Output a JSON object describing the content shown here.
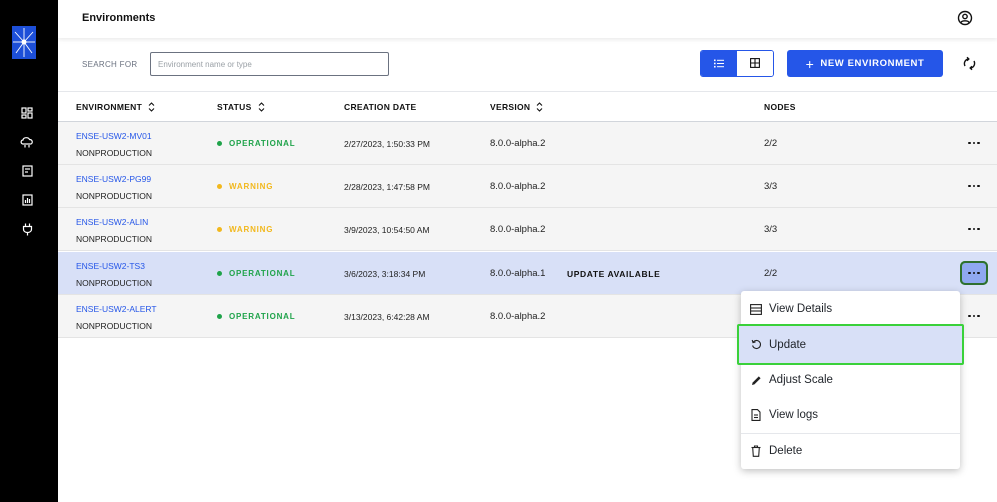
{
  "app": {
    "page_title": "Environments"
  },
  "toolbar": {
    "search_label": "SEARCH FOR",
    "search_placeholder": "Environment name or type",
    "search_value": "",
    "new_env_label": "NEW ENVIRONMENT",
    "new_env_icon": "plus-icon",
    "view_modes": [
      "list-view-icon",
      "grid-view-icon"
    ],
    "active_view": "list"
  },
  "sidebar": {
    "items": [
      {
        "icon": "dashboard-icon"
      },
      {
        "icon": "cloud-icon"
      },
      {
        "icon": "document-icon"
      },
      {
        "icon": "chart-icon"
      },
      {
        "icon": "plug-icon"
      }
    ]
  },
  "table": {
    "columns": [
      "ENVIRONMENT",
      "STATUS",
      "CREATION DATE",
      "VERSION",
      "NODES"
    ],
    "rows": [
      {
        "name": "ENSE-USW2-MV01",
        "type": "NONPRODUCTION",
        "status": "OPERATIONAL",
        "date": "2/27/2023, 1:50:33 PM",
        "version": "8.0.0-alpha.2",
        "update": "",
        "nodes": "2/2"
      },
      {
        "name": "ENSE-USW2-PG99",
        "type": "NONPRODUCTION",
        "status": "WARNING",
        "date": "2/28/2023, 1:47:58 PM",
        "version": "8.0.0-alpha.2",
        "update": "",
        "nodes": "3/3"
      },
      {
        "name": "ENSE-USW2-ALIN",
        "type": "NONPRODUCTION",
        "status": "WARNING",
        "date": "3/9/2023, 10:54:50 AM",
        "version": "8.0.0-alpha.2",
        "update": "",
        "nodes": "3/3"
      },
      {
        "name": "ENSE-USW2-TS3",
        "type": "NONPRODUCTION",
        "status": "OPERATIONAL",
        "date": "3/6/2023, 3:18:34 PM",
        "version": "8.0.0-alpha.1",
        "update": "UPDATE AVAILABLE",
        "nodes": "2/2"
      },
      {
        "name": "ENSE-USW2-ALERT",
        "type": "NONPRODUCTION",
        "status": "OPERATIONAL",
        "date": "3/13/2023, 6:42:28 AM",
        "version": "8.0.0-alpha.2",
        "update": "",
        "nodes": ""
      }
    ]
  },
  "colors": {
    "accent": "#2556e8",
    "operational": "#1fa34a",
    "warning": "#f2b81d",
    "selected_row": "#d8e0f7",
    "highlight_outline": "#3ad13a"
  },
  "menu": {
    "items": [
      {
        "label": "View Details",
        "icon": "table-icon"
      },
      {
        "label": "Update",
        "icon": "refresh-icon"
      },
      {
        "label": "Adjust Scale",
        "icon": "pencil-icon"
      },
      {
        "label": "View logs",
        "icon": "file-icon"
      },
      {
        "label": "Delete",
        "icon": "trash-icon"
      }
    ]
  }
}
